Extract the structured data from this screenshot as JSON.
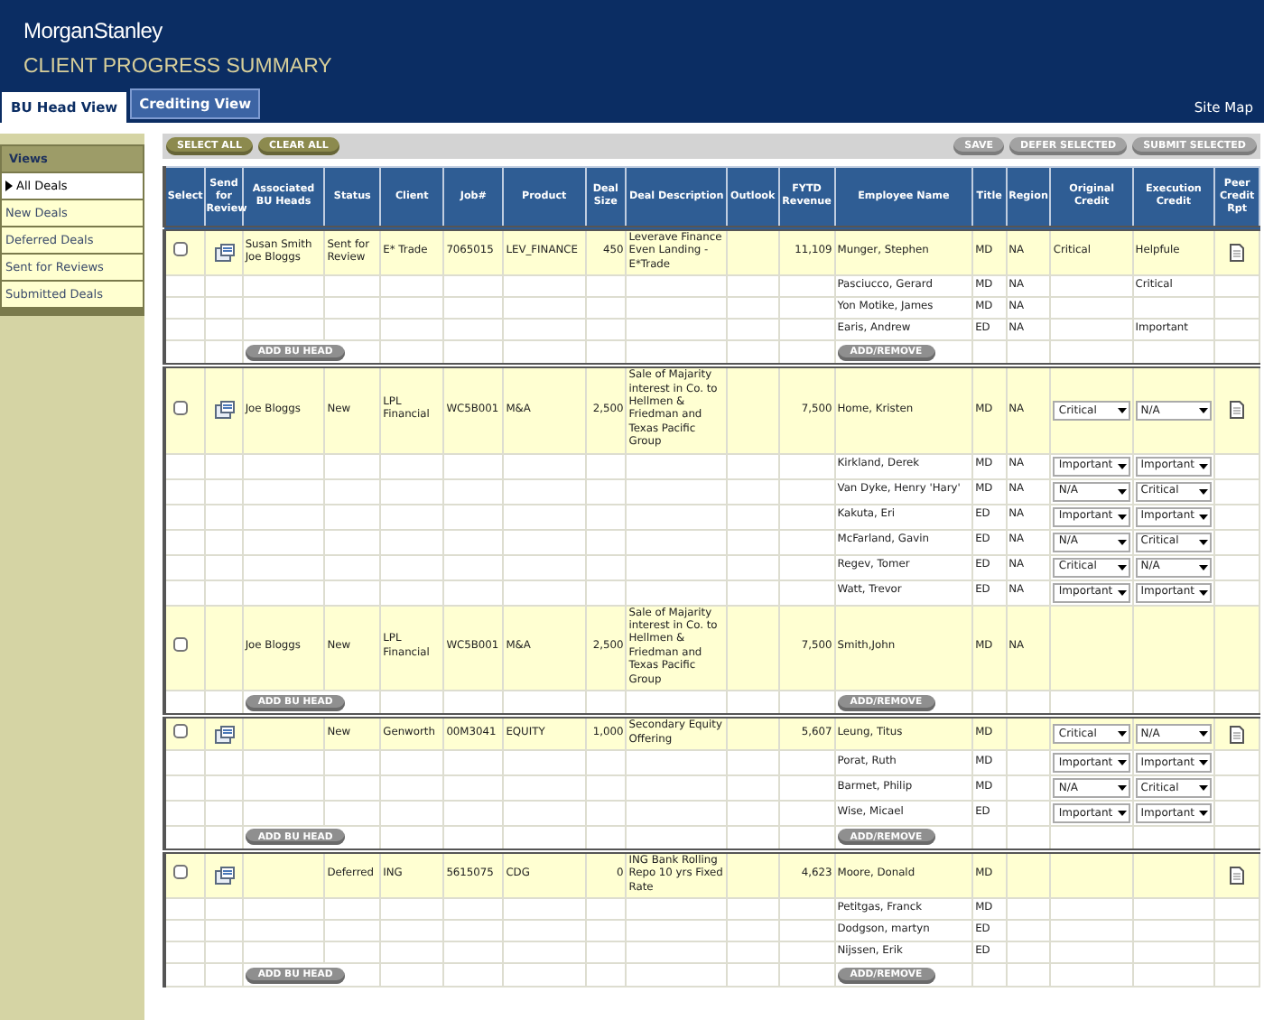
{
  "header": {
    "brand": "MorganStanley",
    "title": "CLIENT PROGRESS SUMMARY",
    "site_map": "Site Map"
  },
  "tabs": [
    {
      "label": "BU Head View",
      "selected": true
    },
    {
      "label": "Crediting View",
      "selected": false
    }
  ],
  "sidebar": {
    "title": "Views",
    "items": [
      {
        "label": "All Deals",
        "selected": true
      },
      {
        "label": "New Deals",
        "selected": false
      },
      {
        "label": "Deferred Deals",
        "selected": false
      },
      {
        "label": "Sent for Reviews",
        "selected": false
      },
      {
        "label": "Submitted Deals",
        "selected": false
      }
    ]
  },
  "toolbar": {
    "left": [
      {
        "label": "SELECT ALL",
        "disabled": false
      },
      {
        "label": "CLEAR ALL",
        "disabled": false
      }
    ],
    "right": [
      {
        "label": "SAVE",
        "disabled": true
      },
      {
        "label": "DEFER SELECTED",
        "disabled": true
      },
      {
        "label": "SUBMIT SELECTED",
        "disabled": true
      }
    ]
  },
  "table": {
    "columns": [
      "Select",
      "Send for Review",
      "Associated BU Heads",
      "Status",
      "Client",
      "Job#",
      "Product",
      "Deal Size",
      "Deal Description",
      "Outlook",
      "FYTD Revenue",
      "Employee Name",
      "Title",
      "Region",
      "Original Credit",
      "Execution Credit",
      "Peer Credit Rpt"
    ],
    "groups": [
      {
        "footer": {
          "add_bu_head": "ADD BU HEAD",
          "add_remove": "ADD/REMOVE"
        },
        "deals": [
          {
            "selected": false,
            "send_icon": true,
            "report_icon": true,
            "bu_heads": [
              "Susan Smith",
              "Joe Bloggs"
            ],
            "status": "Sent for Review",
            "client": "E* Trade",
            "job": "7065015",
            "product": "LEV_FINANCE",
            "deal_size": "450",
            "description": "Leverave Finance Even Landing - E*Trade",
            "fytd_revenue": "11,109",
            "employees": [
              {
                "name": "Munger, Stephen",
                "title": "MD",
                "region": "NA",
                "kind": "text",
                "original_credit": "Critical",
                "execution_credit": "Helpfule"
              },
              {
                "name": "Pasciucco, Gerard",
                "title": "MD",
                "region": "NA",
                "kind": "text",
                "execution_credit": "Critical"
              },
              {
                "name": "Yon Motike, James",
                "title": "MD",
                "region": "NA",
                "kind": "text"
              },
              {
                "name": "Earis, Andrew",
                "title": "ED",
                "region": "NA",
                "kind": "text",
                "execution_credit": "Important"
              }
            ]
          }
        ]
      },
      {
        "footer": {
          "add_bu_head": "ADD BU HEAD",
          "add_remove": "ADD/REMOVE"
        },
        "deals": [
          {
            "selected": false,
            "send_icon": true,
            "report_icon": true,
            "bu_heads": [
              "Joe Bloggs"
            ],
            "status": "New",
            "client": "LPL Financial",
            "job": "WC5B001",
            "product": "M&A",
            "deal_size": "2,500",
            "description": "Sale of Majarity interest in Co. to Hellmen & Friedman and Texas Pacific Group",
            "fytd_revenue": "7,500",
            "employees": [
              {
                "name": "Home, Kristen",
                "title": "MD",
                "region": "NA",
                "kind": "dropdown",
                "original_credit": "Critical",
                "execution_credit": "N/A"
              },
              {
                "name": "Kirkland, Derek",
                "title": "MD",
                "region": "NA",
                "kind": "dropdown",
                "original_credit": "Important",
                "execution_credit": "Important"
              },
              {
                "name": "Van Dyke, Henry 'Hary'",
                "title": "MD",
                "region": "NA",
                "kind": "dropdown",
                "original_credit": "N/A",
                "execution_credit": "Critical"
              },
              {
                "name": "Kakuta, Eri",
                "title": "ED",
                "region": "NA",
                "kind": "dropdown",
                "original_credit": "Important",
                "execution_credit": "Important"
              },
              {
                "name": "McFarland, Gavin",
                "title": "ED",
                "region": "NA",
                "kind": "dropdown",
                "original_credit": "N/A",
                "execution_credit": "Critical"
              },
              {
                "name": "Regev, Tomer",
                "title": "ED",
                "region": "NA",
                "kind": "dropdown",
                "original_credit": "Critical",
                "execution_credit": "N/A"
              },
              {
                "name": "Watt, Trevor",
                "title": "ED",
                "region": "NA",
                "kind": "dropdown",
                "original_credit": "Important",
                "execution_credit": "Important"
              }
            ]
          },
          {
            "selected": false,
            "send_icon": false,
            "report_icon": false,
            "bu_heads": [
              "Joe Bloggs"
            ],
            "status": "New",
            "client": "LPL Financial",
            "job": "WC5B001",
            "product": "M&A",
            "deal_size": "2,500",
            "description": "Sale of Majarity interest in Co. to Hellmen & Friedman and Texas Pacific Group",
            "fytd_revenue": "7,500",
            "employees": [
              {
                "name": "Smith,John",
                "title": "MD",
                "region": "NA",
                "kind": "text"
              }
            ]
          }
        ]
      },
      {
        "footer": {
          "add_bu_head": "ADD BU HEAD",
          "add_remove": "ADD/REMOVE"
        },
        "deals": [
          {
            "selected": false,
            "send_icon": true,
            "report_icon": true,
            "status": "New",
            "client": "Genworth",
            "job": "00M3041",
            "product": "EQUITY",
            "deal_size": "1,000",
            "description": "Secondary Equity Offering",
            "fytd_revenue": "5,607",
            "employees": [
              {
                "name": "Leung, Titus",
                "title": "MD",
                "kind": "dropdown",
                "original_credit": "Critical",
                "execution_credit": "N/A"
              },
              {
                "name": "Porat, Ruth",
                "title": "MD",
                "kind": "dropdown",
                "original_credit": "Important",
                "execution_credit": "Important"
              },
              {
                "name": "Barmet, Philip",
                "title": "MD",
                "kind": "dropdown",
                "original_credit": "N/A",
                "execution_credit": "Critical"
              },
              {
                "name": "Wise, Micael",
                "title": "ED",
                "kind": "dropdown",
                "original_credit": "Important",
                "execution_credit": "Important"
              }
            ]
          }
        ]
      },
      {
        "footer": {
          "add_bu_head": "ADD BU HEAD",
          "add_remove": "ADD/REMOVE"
        },
        "deals": [
          {
            "selected": false,
            "send_icon": true,
            "report_icon": true,
            "status": "Deferred",
            "client": "ING",
            "job": "5615075",
            "product": "CDG",
            "deal_size": "0",
            "description": "ING Bank Rolling Repo 10 yrs Fixed Rate",
            "fytd_revenue": "4,623",
            "employees": [
              {
                "name": "Moore, Donald",
                "title": "MD",
                "kind": "text"
              },
              {
                "name": "Petitgas, Franck",
                "title": "MD",
                "kind": "text"
              },
              {
                "name": "Dodgson, martyn",
                "title": "ED",
                "kind": "text"
              },
              {
                "name": "Nijssen, Erik",
                "title": "ED",
                "kind": "text"
              }
            ]
          }
        ]
      }
    ]
  }
}
